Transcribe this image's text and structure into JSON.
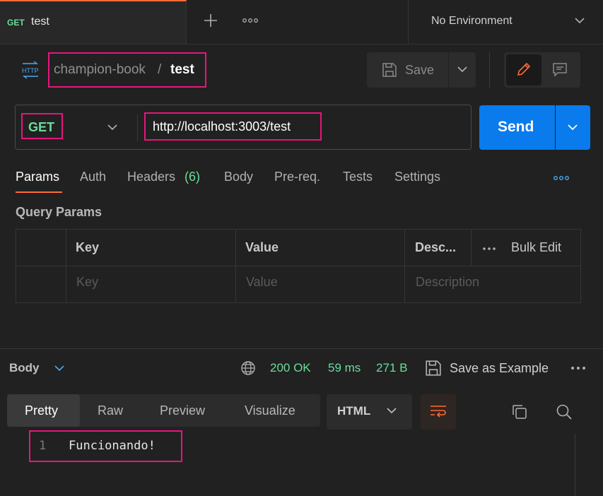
{
  "tab": {
    "method": "GET",
    "title": "test"
  },
  "environment": {
    "label": "No Environment"
  },
  "breadcrumb": {
    "parent": "champion-book",
    "separator": "/",
    "current": "test"
  },
  "toolbar": {
    "save_label": "Save"
  },
  "request": {
    "method": "GET",
    "url": "http://localhost:3003/test",
    "send_label": "Send"
  },
  "request_tabs": {
    "params": "Params",
    "auth": "Auth",
    "headers": "Headers",
    "headers_count": "(6)",
    "body": "Body",
    "prereq": "Pre-req.",
    "tests": "Tests",
    "settings": "Settings"
  },
  "query_params": {
    "title": "Query Params",
    "headers": {
      "key": "Key",
      "value": "Value",
      "description": "Desc...",
      "bulk_edit": "Bulk Edit"
    },
    "placeholder_row": {
      "key": "Key",
      "value": "Value",
      "description": "Description"
    }
  },
  "response": {
    "body_label": "Body",
    "status": "200 OK",
    "time": "59 ms",
    "size": "271 B",
    "save_example_label": "Save as Example",
    "view_tabs": {
      "pretty": "Pretty",
      "raw": "Raw",
      "preview": "Preview",
      "visualize": "Visualize"
    },
    "format": "HTML",
    "lines": [
      {
        "number": "1",
        "text": "Funcionando!"
      }
    ]
  },
  "colors": {
    "accent": "#ff6c37",
    "method_get": "#6bdd9a",
    "send_button": "#097bed",
    "highlight_box": "#e8157d",
    "background": "#212121"
  },
  "icons": [
    "plus-icon",
    "more-icon",
    "chevron-down-icon",
    "http-icon",
    "save-icon",
    "pencil-icon",
    "comment-icon",
    "globe-icon",
    "wrap-icon",
    "copy-icon",
    "search-icon"
  ]
}
